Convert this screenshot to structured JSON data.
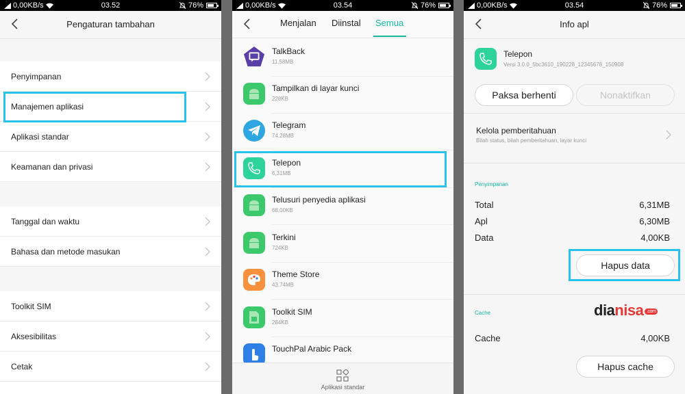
{
  "status_bars": [
    {
      "net": "0,00KB/s",
      "time": "03.52",
      "battery": "76%"
    },
    {
      "net": "0,00KB/s",
      "time": "03.54",
      "battery": "76%"
    },
    {
      "net": "0,00KB/s",
      "time": "03.54",
      "battery": "76%"
    }
  ],
  "screen1": {
    "title": "Pengaturan tambahan",
    "items": [
      "Penyimpanan",
      "Manajemen aplikasi",
      "Aplikasi standar",
      "Keamanan dan privasi",
      "Tanggal dan waktu",
      "Bahasa dan metode masukan",
      "Toolkit SIM",
      "Aksesibilitas",
      "Cetak"
    ]
  },
  "screen2": {
    "tabs": [
      "Menjalan",
      "Diinstal",
      "Semua"
    ],
    "active_tab": "Semua",
    "apps": [
      {
        "name": "TalkBack",
        "size": "11,58MB",
        "icon": "talkback-icon",
        "color": "#5b3fa8"
      },
      {
        "name": "Tampilkan di layar kunci",
        "size": "228KB",
        "icon": "android-icon",
        "color": "#3cc96b"
      },
      {
        "name": "Telegram",
        "size": "74,28MB",
        "icon": "telegram-icon",
        "color": "#2ea6e0"
      },
      {
        "name": "Telepon",
        "size": "6,31MB",
        "icon": "phone-icon",
        "color": "#2ed39b"
      },
      {
        "name": "Telusuri penyedia aplikasi",
        "size": "68,00KB",
        "icon": "android-icon",
        "color": "#3cc96b"
      },
      {
        "name": "Terkini",
        "size": "724KB",
        "icon": "android-icon",
        "color": "#3cc96b"
      },
      {
        "name": "Theme Store",
        "size": "43,74MB",
        "icon": "palette-icon",
        "color": "#f7913d"
      },
      {
        "name": "Toolkit SIM",
        "size": "284KB",
        "icon": "sim-icon",
        "color": "#3cc96b"
      },
      {
        "name": "TouchPal Arabic Pack",
        "size": "",
        "icon": "touchpal-icon",
        "color": "#2f80e6"
      }
    ],
    "bottom_label": "Aplikasi standar"
  },
  "screen3": {
    "title": "Info apl",
    "app_name": "Telepon",
    "version": "Versi 3.0.0_5bc3610_190228_12345678_150908",
    "force_stop": "Paksa berhenti",
    "disable": "Nonaktifkan",
    "notif_title": "Kelola pemberitahuan",
    "notif_sub": "Bilah status, bilah pemberitahuan, layar kunci",
    "storage_label": "Penyimpanan",
    "storage": [
      {
        "k": "Total",
        "v": "6,31MB"
      },
      {
        "k": "Apl",
        "v": "6,30MB"
      },
      {
        "k": "Data",
        "v": "4,00KB"
      }
    ],
    "clear_data": "Hapus data",
    "cache_label": "Cache",
    "cache_key": "Cache",
    "cache_value": "4,00KB",
    "clear_cache": "Hapus cache",
    "logo_a": "dia",
    "logo_b": "nisa",
    "logo_c": ".com"
  },
  "colors": {
    "accent": "#13b8a0",
    "highlight": "#29c3ea"
  }
}
